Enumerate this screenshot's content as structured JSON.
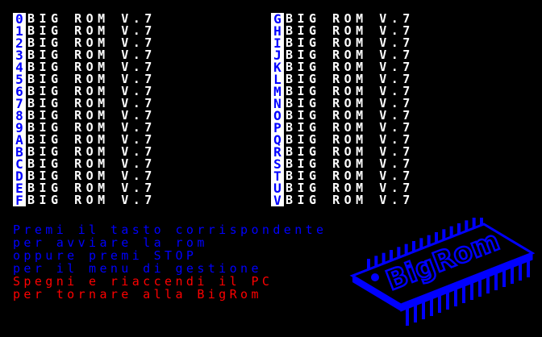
{
  "rom_list": {
    "left": [
      {
        "key": "0",
        "name": "BIG ROM V.7"
      },
      {
        "key": "1",
        "name": "BIG ROM V.7"
      },
      {
        "key": "2",
        "name": "BIG ROM V.7"
      },
      {
        "key": "3",
        "name": "BIG ROM V.7"
      },
      {
        "key": "4",
        "name": "BIG ROM V.7"
      },
      {
        "key": "5",
        "name": "BIG ROM V.7"
      },
      {
        "key": "6",
        "name": "BIG ROM V.7"
      },
      {
        "key": "7",
        "name": "BIG ROM V.7"
      },
      {
        "key": "8",
        "name": "BIG ROM V.7"
      },
      {
        "key": "9",
        "name": "BIG ROM V.7"
      },
      {
        "key": "A",
        "name": "BIG ROM V.7"
      },
      {
        "key": "B",
        "name": "BIG ROM V.7"
      },
      {
        "key": "C",
        "name": "BIG ROM V.7"
      },
      {
        "key": "D",
        "name": "BIG ROM V.7"
      },
      {
        "key": "E",
        "name": "BIG ROM V.7"
      },
      {
        "key": "F",
        "name": "BIG ROM V.7"
      }
    ],
    "right": [
      {
        "key": "G",
        "name": "BIG ROM V.7"
      },
      {
        "key": "H",
        "name": "BIG ROM V.7"
      },
      {
        "key": "I",
        "name": "BIG ROM V.7"
      },
      {
        "key": "J",
        "name": "BIG ROM V.7"
      },
      {
        "key": "K",
        "name": "BIG ROM V.7"
      },
      {
        "key": "L",
        "name": "BIG ROM V.7"
      },
      {
        "key": "M",
        "name": "BIG ROM V.7"
      },
      {
        "key": "N",
        "name": "BIG ROM V.7"
      },
      {
        "key": "O",
        "name": "BIG ROM V.7"
      },
      {
        "key": "P",
        "name": "BIG ROM V.7"
      },
      {
        "key": "Q",
        "name": "BIG ROM V.7"
      },
      {
        "key": "R",
        "name": "BIG ROM V.7"
      },
      {
        "key": "S",
        "name": "BIG ROM V.7"
      },
      {
        "key": "T",
        "name": "BIG ROM V.7"
      },
      {
        "key": "U",
        "name": "BIG ROM V.7"
      },
      {
        "key": "V",
        "name": "BIG ROM V.7"
      }
    ]
  },
  "instructions": [
    {
      "text": "Premi il tasto corrispondente",
      "color": "#0000ff"
    },
    {
      "text": "per avviare la rom",
      "color": "#0000ff"
    },
    {
      "text": "oppure premi STOP",
      "color": "#0000ff"
    },
    {
      "text": "per il menu di gestione",
      "color": "#0000ff"
    },
    {
      "text": "Spegni e riaccendi il PC",
      "color": "#ff0000"
    },
    {
      "text": "per tornare alla BigRom",
      "color": "#ff0000"
    }
  ],
  "logo": {
    "text": "BigRom",
    "icon": "rom-chip-icon"
  },
  "colors": {
    "background": "#000000",
    "rom_text": "#ffffff",
    "key_background": "#ffffff",
    "key_text": "#0000ff",
    "logo": "#0000ff"
  }
}
